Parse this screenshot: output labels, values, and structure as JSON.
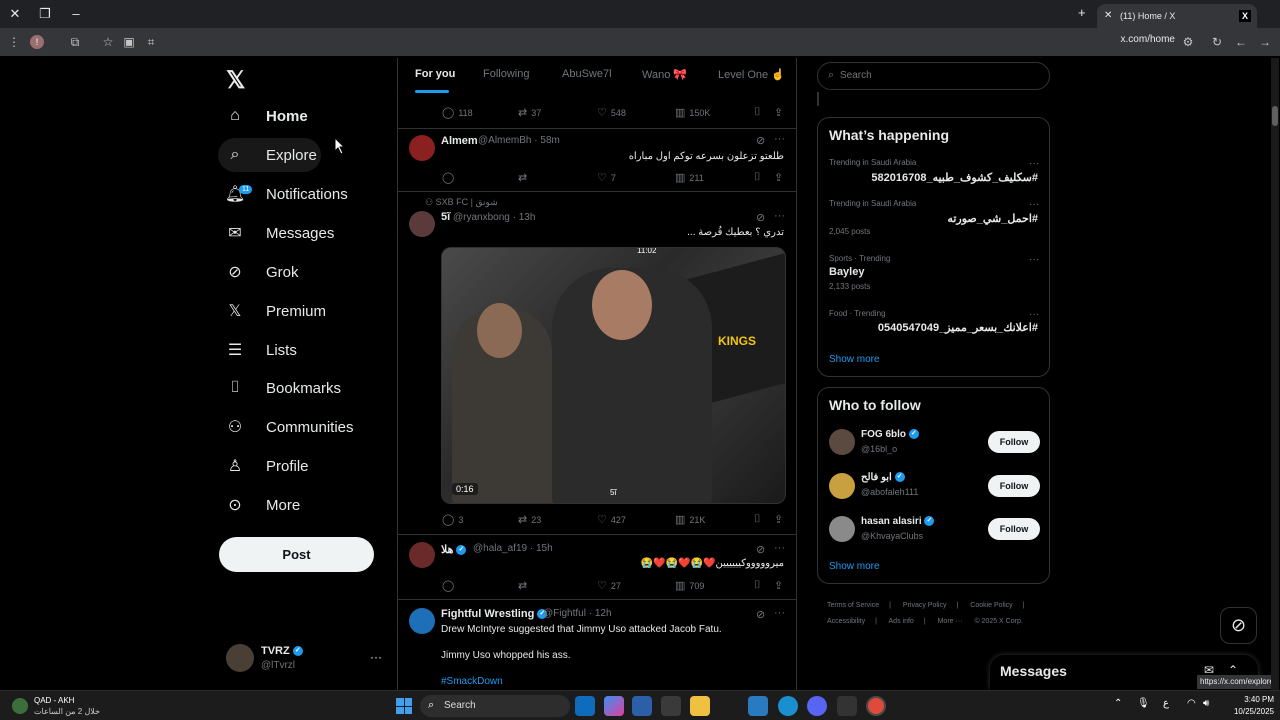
{
  "browser": {
    "tab_title": "(11) Home / X",
    "url": "x.com/home",
    "url_tooltip": "https://x.com/explore",
    "new_tab": "+",
    "close_tab": "✕"
  },
  "nav": {
    "items": [
      {
        "label": "Home",
        "icon": "home-icon"
      },
      {
        "label": "Explore",
        "icon": "search-icon"
      },
      {
        "label": "Notifications",
        "icon": "bell-icon",
        "badge": "11"
      },
      {
        "label": "Messages",
        "icon": "envelope-icon"
      },
      {
        "label": "Grok",
        "icon": "grok-icon"
      },
      {
        "label": "Premium",
        "icon": "x-icon"
      },
      {
        "label": "Lists",
        "icon": "list-icon"
      },
      {
        "label": "Bookmarks",
        "icon": "bookmark-icon"
      },
      {
        "label": "Communities",
        "icon": "people-icon"
      },
      {
        "label": "Profile",
        "icon": "person-icon"
      },
      {
        "label": "More",
        "icon": "more-circle-icon"
      }
    ],
    "post_label": "Post",
    "account": {
      "name": "TVRZ",
      "handle": "@lTvrzl"
    }
  },
  "timeline": {
    "tabs": [
      "For you",
      "Following",
      "AbuSwe7l",
      "Wano 🎀",
      "Level One ☝"
    ],
    "top_actions": {
      "replies": "118",
      "reposts": "37",
      "likes": "548",
      "views": "150K"
    },
    "tweets": [
      {
        "name": "Almem",
        "handle": "@AlmemBh · 58m",
        "text": "طلعتو تزعلون بسرعه توكم اول مباراه",
        "replies": "",
        "reposts": "",
        "likes": "7",
        "views": "211"
      },
      {
        "context": "SXB FC | شونق",
        "name": "5ĩ",
        "handle": "@ryanxbong · 13h",
        "text": "تدري ؟ بعطيك فُرصة ...",
        "media": {
          "duration": "0:16",
          "overlay_text": "KINGS",
          "watermark": "5ĩ",
          "top_text": "11:02"
        },
        "replies": "3",
        "reposts": "23",
        "likes": "427",
        "views": "21K"
      },
      {
        "name": "هلا",
        "handle": "@hala_af19 · 15h",
        "text": "ميروووووكيييييين❤️😭❤️😭❤️😭",
        "replies": "",
        "reposts": "",
        "likes": "27",
        "views": "709"
      },
      {
        "name": "Fightful Wrestling",
        "handle": "@Fightful · 12h",
        "text1": "Drew McIntyre suggested that Jimmy Uso attacked Jacob Fatu.",
        "text2": "Jimmy Uso whopped his ass.",
        "hashtag": "#SmackDown"
      }
    ]
  },
  "sidebar": {
    "search_placeholder": "Search",
    "happening": {
      "title": "What’s happening",
      "trends": [
        {
          "context": "Trending in Saudi Arabia",
          "name": "#سكليف_كشوف_طبيه_582016708",
          "count": ""
        },
        {
          "context": "Trending in Saudi Arabia",
          "name": "#احمل_شي_صورته",
          "count": "2,045 posts"
        },
        {
          "context": "Sports · Trending",
          "name": "Bayley",
          "count": "2,133 posts"
        },
        {
          "context": "Food · Trending",
          "name": "#اعلانك_بسعر_مميز_0540547049",
          "count": ""
        }
      ],
      "show_more": "Show more"
    },
    "who_to_follow": {
      "title": "Who to follow",
      "accounts": [
        {
          "name": "FOG 6blo",
          "handle": "@16bl_o"
        },
        {
          "name": "ابو فالح",
          "handle": "@abofaleh111"
        },
        {
          "name": "hasan alasiri",
          "handle": "@KhvayaClubs"
        }
      ],
      "follow_label": "Follow",
      "show_more": "Show more"
    },
    "footer": {
      "line1": [
        "Terms of Service",
        "|",
        "Privacy Policy",
        "|",
        "Cookie Policy",
        "|"
      ],
      "line2": [
        "Accessibility",
        "|",
        "Ads info",
        "|",
        "More ···",
        "© 2025 X Corp."
      ]
    },
    "messages_title": "Messages"
  },
  "taskbar": {
    "weather_line1": "QAD - AKH",
    "weather_line2": "خلال 2 من الساعات",
    "search": "Search",
    "time": "3:40 PM",
    "date": "10/25/2025",
    "lang": "ع"
  }
}
